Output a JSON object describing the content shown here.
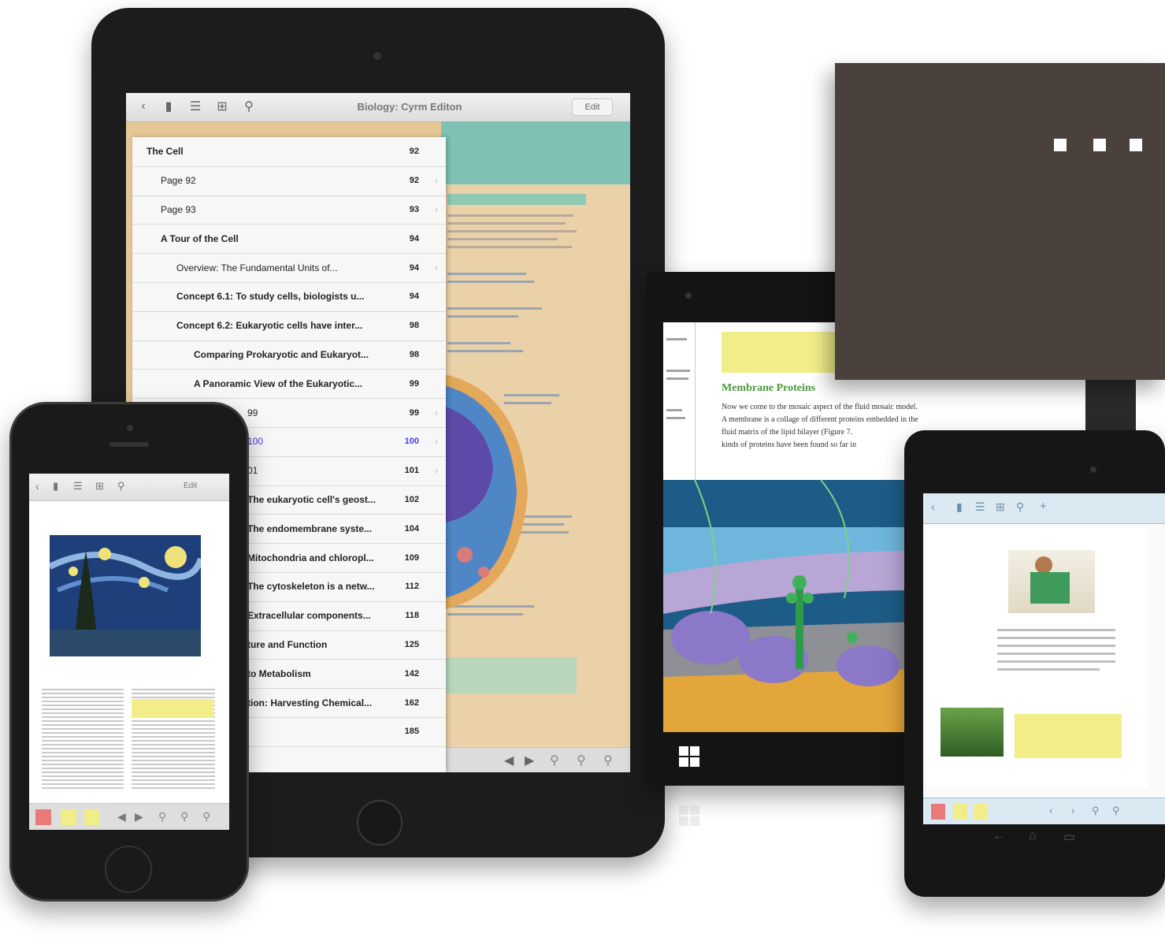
{
  "colors": {
    "card": "#4a403c",
    "bezel": "#151515",
    "accent_teal": "#7fc2b4",
    "page_beige": "#e9cfa3",
    "link_blue": "#3d3de0",
    "highlight_yellow": "#f1ee8a",
    "bookmark_red": "#e87a7a"
  },
  "ipad": {
    "book_title": "Biology: Cyrm Editon",
    "toolbar_right": "Edit",
    "toc": [
      {
        "title": "The Cell",
        "page": "92",
        "level": 0,
        "bold": true,
        "chevron": false
      },
      {
        "title": "Page 92",
        "page": "92",
        "level": 1,
        "bold": false,
        "chevron": true
      },
      {
        "title": "Page 93",
        "page": "93",
        "level": 1,
        "bold": false,
        "chevron": true
      },
      {
        "title": "A Tour of the Cell",
        "page": "94",
        "level": 1,
        "bold": true,
        "chevron": false
      },
      {
        "title": "Overview: The Fundamental Units of...",
        "page": "94",
        "level": 2,
        "bold": false,
        "chevron": true
      },
      {
        "title": "Concept 6.1: To study cells, biologists u...",
        "page": "94",
        "level": 2,
        "bold": true,
        "chevron": false
      },
      {
        "title": "Concept 6.2: Eukaryotic cells have inter...",
        "page": "98",
        "level": 2,
        "bold": true,
        "chevron": false
      },
      {
        "title": "Comparing Prokaryotic and Eukaryot...",
        "page": "98",
        "level": 3,
        "bold": true,
        "chevron": false
      },
      {
        "title": "A Panoramic View of the Eukaryotic...",
        "page": "99",
        "level": 3,
        "bold": true,
        "chevron": false
      },
      {
        "title": "99",
        "page": "99",
        "level": 4,
        "bold": false,
        "chevron": true
      },
      {
        "title": "100",
        "page": "100",
        "level": 4,
        "bold": false,
        "chevron": true,
        "link": true
      },
      {
        "title": "01",
        "page": "101",
        "level": 4,
        "bold": false,
        "chevron": true
      },
      {
        "title": "The eukaryotic cell's geost...",
        "page": "102",
        "level": 4,
        "bold": true,
        "chevron": false
      },
      {
        "title": "The endomembrane syste...",
        "page": "104",
        "level": 4,
        "bold": true,
        "chevron": false
      },
      {
        "title": "Mitochondria and chloropl...",
        "page": "109",
        "level": 4,
        "bold": true,
        "chevron": false
      },
      {
        "title": "The cytoskeleton is a netw...",
        "page": "112",
        "level": 4,
        "bold": true,
        "chevron": false
      },
      {
        "title": "Extracellular components...",
        "page": "118",
        "level": 4,
        "bold": true,
        "chevron": false
      },
      {
        "title": "ture and Function",
        "page": "125",
        "level": 4,
        "bold": true,
        "chevron": false
      },
      {
        "title": "to Metabolism",
        "page": "142",
        "level": 4,
        "bold": true,
        "chevron": false
      },
      {
        "title": "tion: Harvesting Chemical...",
        "page": "162",
        "level": 4,
        "bold": true,
        "chevron": false
      },
      {
        "title": "",
        "page": "185",
        "level": 4,
        "bold": true,
        "chevron": false
      }
    ]
  },
  "surface": {
    "heading": "Membrane Proteins",
    "body": [
      "Now we come to the mosaic aspect of the fluid mosaic model.",
      "A membrane is a collage of different proteins embedded in the",
      "fluid matrix of the lipid bilayer (Figure 7.",
      "kinds of proteins have been found so far in"
    ]
  },
  "iphone": {
    "toolbar_right": "Edit"
  }
}
